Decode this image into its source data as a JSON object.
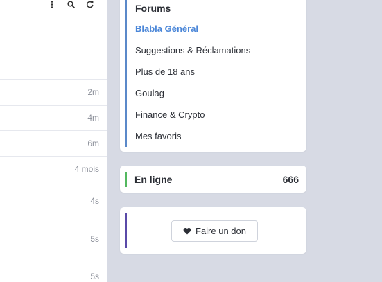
{
  "toolbar": {
    "icons": [
      "more-vertical-icon",
      "search-icon",
      "refresh-icon"
    ]
  },
  "topics": [
    {
      "time": "2m"
    },
    {
      "time": "4m"
    },
    {
      "time": "6m"
    },
    {
      "time": "4 mois"
    },
    {
      "time": "4s"
    },
    {
      "time": "5s"
    },
    {
      "time": "5s"
    }
  ],
  "forums": {
    "title": "Forums",
    "items": [
      {
        "label": "Blabla Général",
        "active": true
      },
      {
        "label": "Suggestions & Réclamations",
        "active": false
      },
      {
        "label": "Plus de 18 ans",
        "active": false
      },
      {
        "label": "Goulag",
        "active": false
      },
      {
        "label": "Finance & Crypto",
        "active": false
      },
      {
        "label": "Mes favoris",
        "active": false
      }
    ]
  },
  "online": {
    "label": "En ligne",
    "count": "666"
  },
  "donate": {
    "label": "Faire un don",
    "icon": "heart-icon"
  },
  "colors": {
    "page_background": "#d7dae4",
    "forums_accent": "#5b89c9",
    "active_link": "#4a86d8",
    "online_accent": "#53b85f",
    "donate_accent": "#5a4aa8"
  }
}
